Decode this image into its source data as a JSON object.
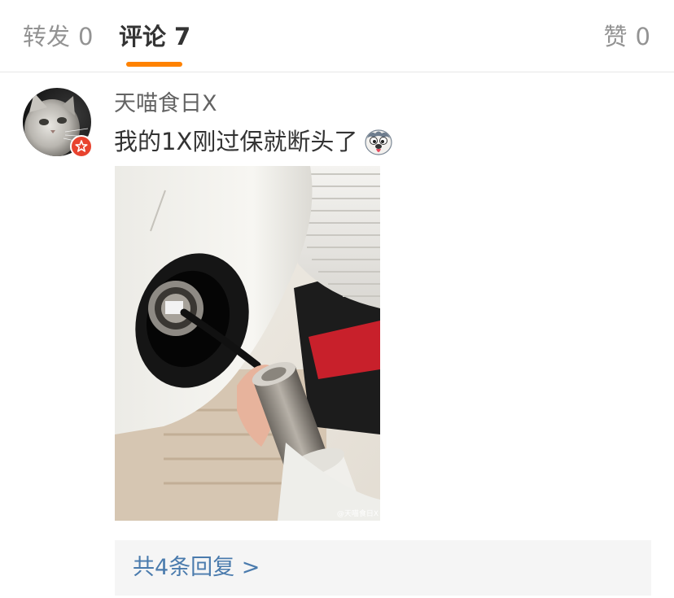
{
  "tabs": {
    "repost": {
      "label": "转发",
      "count": "0"
    },
    "comments": {
      "label": "评论",
      "count": "7"
    },
    "likes": {
      "label": "赞",
      "count": "0"
    }
  },
  "comment": {
    "username": "天喵食日X",
    "text": "我的1X刚过保就断头了",
    "emoji": "doge-tongue-emoji",
    "photo_watermark": "@天喵食日X",
    "replies_link": "共4条回复 >"
  },
  "colors": {
    "accent": "#ff8200",
    "link": "#4a7bad",
    "badge": "#e8432f",
    "muted": "#939393"
  }
}
